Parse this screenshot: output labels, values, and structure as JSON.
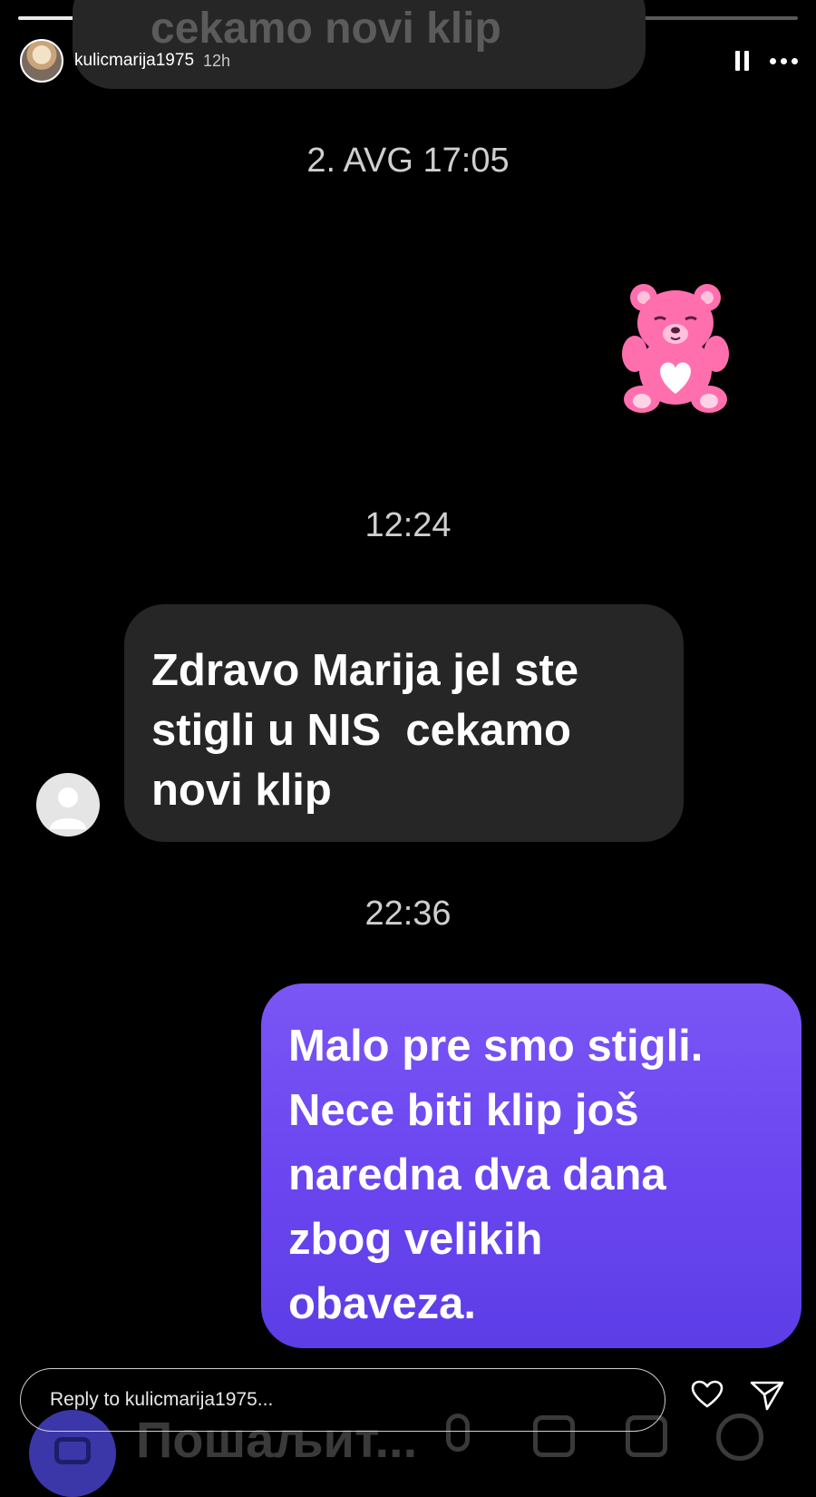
{
  "story": {
    "progress": [
      1.0,
      0.0,
      0.0,
      0.0
    ],
    "username": "kulicmarija1975",
    "time_ago": "12h"
  },
  "chat": {
    "previous_message_partial": "cekamo novi klip",
    "timestamps": {
      "first": "2. AVG 17:05",
      "second": "12:24",
      "third": "22:36"
    },
    "incoming_message": "Zdravo Marija jel ste\nstigli u NIS  cekamo\nnovi klip",
    "outgoing_message": "Malo pre smo stigli.\nNece biti klip još\nnaredna dva dana\nzbog velikih\nobaveza.",
    "sticker": "pink-teddy-bear"
  },
  "reply": {
    "placeholder": "Reply to kulicmarija1975..."
  },
  "ghost_composer": {
    "text": "Пошаљит..."
  },
  "colors": {
    "background": "#000000",
    "incoming_bubble": "#262626",
    "outgoing_bubble": "#6a45f0"
  },
  "icons": [
    "pause-icon",
    "more-icon",
    "heart-icon",
    "send-icon",
    "camera-icon",
    "mic-icon",
    "gallery-icon",
    "sticker-icon",
    "plus-icon"
  ]
}
